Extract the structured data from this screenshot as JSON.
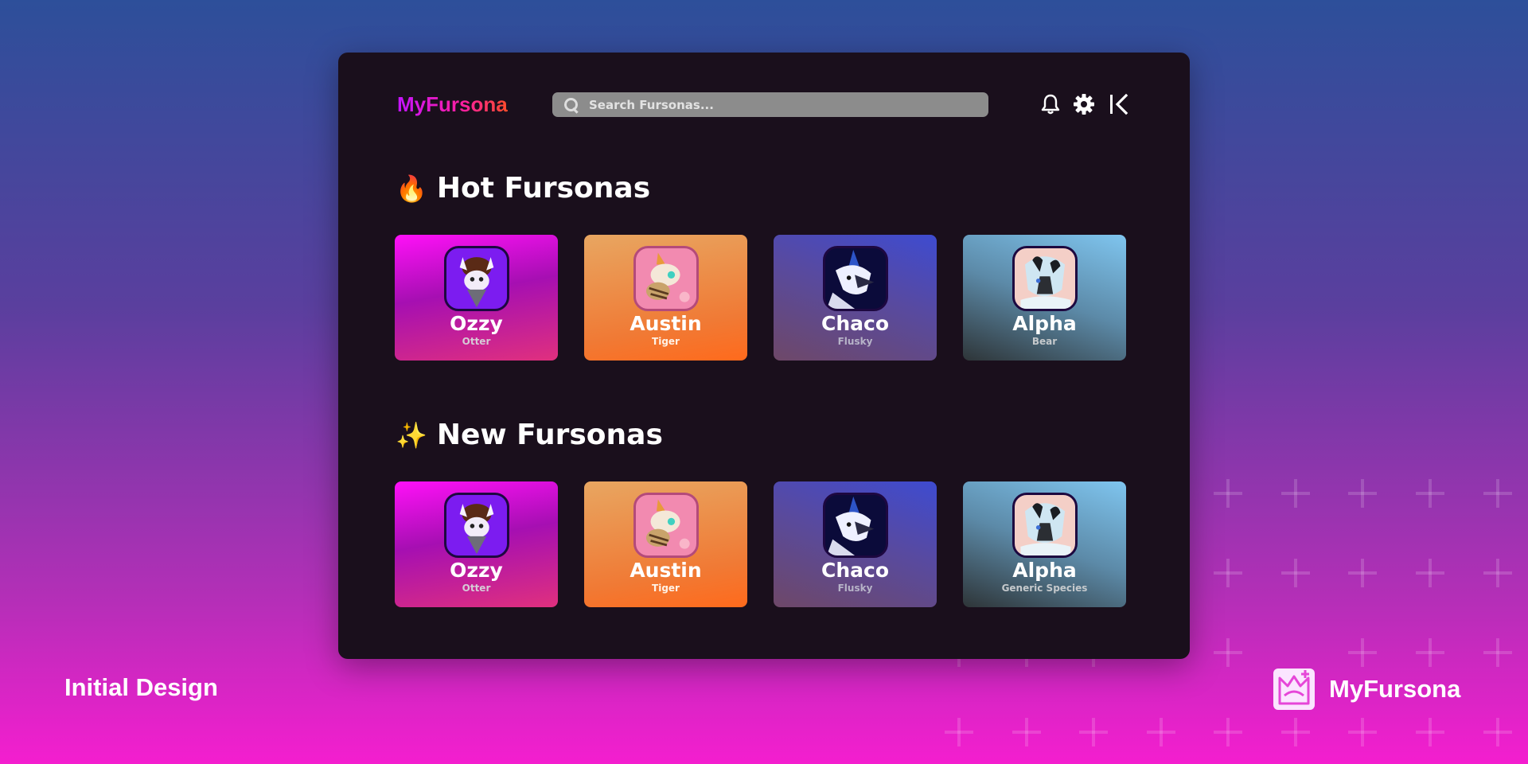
{
  "header": {
    "logo": "MyFursona",
    "search_placeholder": "Search Fursonas...",
    "icons": [
      "bell-icon",
      "gear-icon",
      "collapse-icon"
    ]
  },
  "sections": [
    {
      "emoji": "🔥",
      "title": "Hot Fursonas",
      "cards": [
        {
          "name": "Ozzy",
          "species": "Otter"
        },
        {
          "name": "Austin",
          "species": "Tiger"
        },
        {
          "name": "Chaco",
          "species": "Flusky"
        },
        {
          "name": "Alpha",
          "species": "Bear"
        }
      ]
    },
    {
      "emoji": "✨",
      "title": "New Fursonas",
      "cards": [
        {
          "name": "Ozzy",
          "species": "Otter"
        },
        {
          "name": "Austin",
          "species": "Tiger"
        },
        {
          "name": "Chaco",
          "species": "Flusky"
        },
        {
          "name": "Alpha",
          "species": "Generic Species"
        }
      ]
    }
  ],
  "footer": {
    "caption": "Initial Design",
    "brand": "MyFursona"
  },
  "colors": {
    "window_bg": "#1a0f1c",
    "accent_purple": "#c313ff",
    "accent_orange": "#ff4c2a"
  }
}
